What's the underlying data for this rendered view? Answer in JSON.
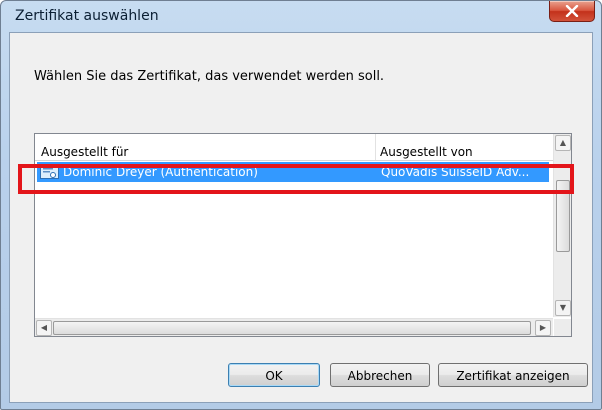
{
  "window": {
    "title": "Zertifikat auswählen",
    "close_label": "x"
  },
  "prompt": "Wählen Sie das Zertifikat, das verwendet werden soll.",
  "list": {
    "columns": [
      "Ausgestellt für",
      "Ausgestellt von"
    ],
    "rows": [
      {
        "issued_to": "Dominic Dreyer (Authentication)",
        "issued_by": "QuoVadis SuisseID Adv...",
        "selected": true,
        "icon": "certificate-icon"
      }
    ],
    "scroll_icons": {
      "up": "▲",
      "down": "▼",
      "left": "◀",
      "right": "▶"
    }
  },
  "buttons": {
    "ok": "OK",
    "cancel": "Abbrechen",
    "view": "Zertifikat anzeigen"
  },
  "colors": {
    "selection": "#3399ff",
    "highlight_frame": "#e3151a",
    "close_button": "#c3311b"
  }
}
